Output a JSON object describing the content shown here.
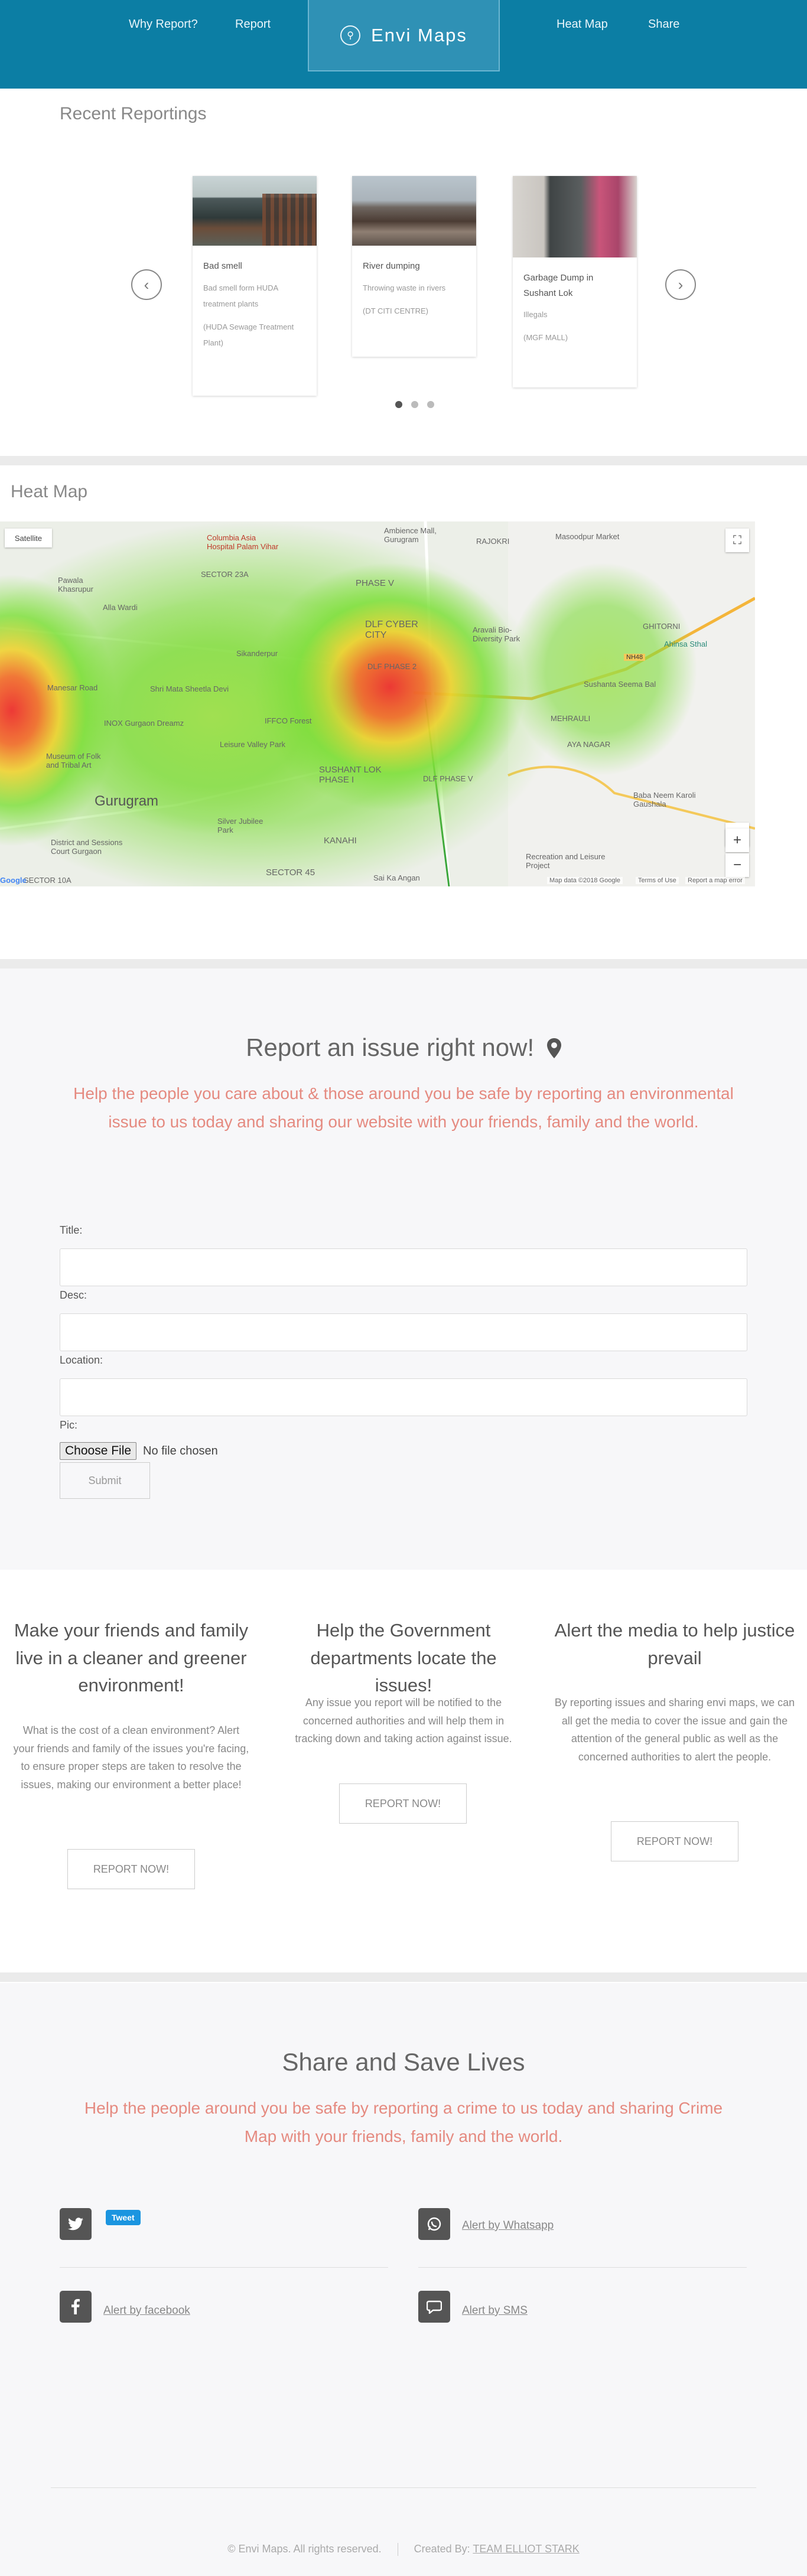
{
  "nav": {
    "why": "Why Report?",
    "report": "Report",
    "brand": "Envi Maps",
    "heatmap": "Heat Map",
    "share": "Share"
  },
  "recent": {
    "title": "Recent Reportings",
    "cards": [
      {
        "title": "Bad smell",
        "desc": "Bad smell form HUDA treatment plants",
        "location": "(HUDA Sewage Treatment Plant)"
      },
      {
        "title": "River dumping",
        "desc": "Throwing waste in rivers",
        "location": "(DT CITI CENTRE)"
      },
      {
        "title": "Garbage Dump in Sushant Lok",
        "desc": "Illegals",
        "location": "(MGF MALL)"
      }
    ]
  },
  "heatmap": {
    "title": "Heat Map",
    "satellite": "Satellite",
    "attribution": "Map data ©2018 Google",
    "terms": "Terms of Use",
    "report_error": "Report a map error",
    "google": "Google",
    "places": [
      "Columbia Asia Hospital Palam Vihar",
      "SECTOR 23A",
      "Pawala Khasrupur",
      "Alla Wardi",
      "Ambience Mall, Gurugram",
      "RAJOKRI",
      "Masoodpur Market",
      "PHASE V",
      "DLF CYBER CITY",
      "Aravali Bio-Diversity Park",
      "GHITORNI",
      "Ahinsa Sthal",
      "Shri Mata Sheetla Devi",
      "INOX Gurgaon Dreamz",
      "DLF PHASE 2",
      "Sushanta Seema Bal",
      "IFFCO Forest",
      "Leisure Valley Park",
      "MEHRAULI",
      "AYA NAGAR",
      "Museum of Folk and Tribal Art",
      "SUSHANT LOK PHASE I",
      "DLF PHASE V",
      "Baba Neem Karoli Gaushala",
      "Gurugram",
      "KANAHI",
      "District and Sessions Court Gurgaon",
      "Silver Jubilee Park",
      "Recreation and Leisure Project",
      "SECTOR 45",
      "Sai Ka Angan",
      "SECTOR 10A",
      "Manesar Road",
      "Sikanderpur",
      "NH48"
    ]
  },
  "report": {
    "title": "Report an issue right now!",
    "lead": "Help the people you care about & those around you be safe by reporting an environmental issue to us today and sharing our website with your friends, family and the world.",
    "title_label": "Title:",
    "desc_label": "Desc:",
    "location_label": "Location:",
    "pic_label": "Pic:",
    "choose_file": "Choose File",
    "no_file": "No file chosen",
    "submit": "Submit"
  },
  "features": [
    {
      "title": "Make your friends and family live in a cleaner and greener environment!",
      "text": "What is the cost of a clean environment? Alert your friends and family of the issues you're facing, to ensure proper steps are taken to resolve the issues, making our environment a better place!",
      "button": "REPORT NOW!"
    },
    {
      "title": "Help the Government departments locate the issues!",
      "text": "Any issue you report will be notified to the concerned authorities and will help them in tracking down and taking action against issue.",
      "button": "REPORT NOW!"
    },
    {
      "title": "Alert the media to help justice prevail",
      "text": "By reporting issues and sharing envi maps, we can all get the media to cover the issue and gain the attention of the general public as well as the concerned authorities to alert the people.",
      "button": "REPORT NOW!"
    }
  ],
  "share": {
    "title": "Share and Save Lives",
    "lead": "Help the people around you be safe by reporting a crime to us today and sharing Crime Map with your friends, family and the world.",
    "tweet": "Tweet",
    "whatsapp": "Alert by Whatsapp",
    "facebook": "Alert by facebook",
    "sms": "Alert by SMS"
  },
  "footer": {
    "copyright": "© Envi Maps. All rights reserved.",
    "created_by": "Created By:",
    "team": "TEAM ELLIOT STARK"
  }
}
